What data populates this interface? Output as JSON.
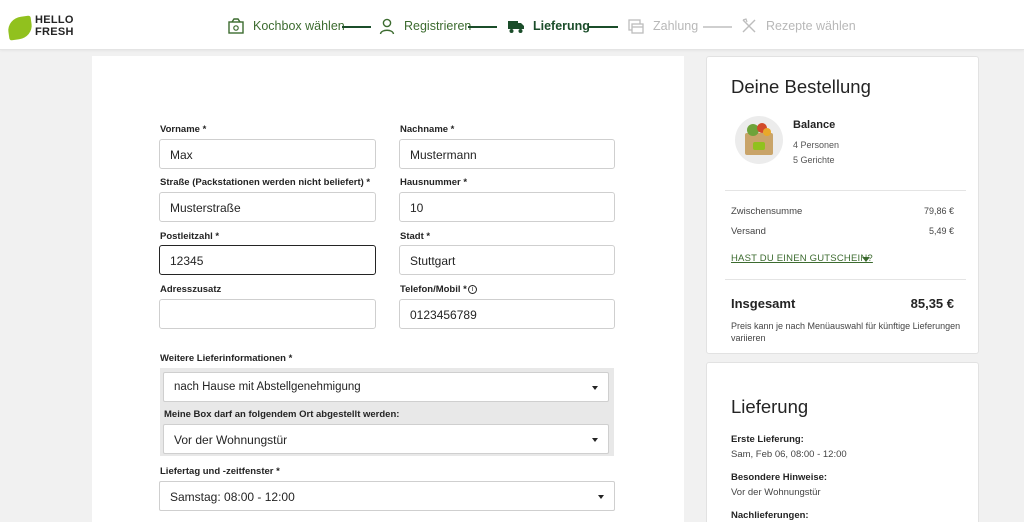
{
  "logo": {
    "line1": "HELLO",
    "line2": "FRESH"
  },
  "steps": [
    {
      "label": "Kochbox wählen",
      "icon": "box-icon",
      "state": "done"
    },
    {
      "label": "Registrieren",
      "icon": "user-icon",
      "state": "done"
    },
    {
      "label": "Lieferung",
      "icon": "truck-icon",
      "state": "current"
    },
    {
      "label": "Zahlung",
      "icon": "payment-icon",
      "state": "todo"
    },
    {
      "label": "Rezepte wählen",
      "icon": "cutlery-icon",
      "state": "todo"
    }
  ],
  "form": {
    "vorname": {
      "label": "Vorname *",
      "value": "Max"
    },
    "nachname": {
      "label": "Nachname *",
      "value": "Mustermann"
    },
    "strasse": {
      "label": "Straße (Packstationen werden nicht beliefert) *",
      "value": "Musterstraße"
    },
    "hausnummer": {
      "label": "Hausnummer *",
      "value": "10"
    },
    "plz": {
      "label": "Postleitzahl *",
      "value": "12345"
    },
    "stadt": {
      "label": "Stadt *",
      "value": "Stuttgart"
    },
    "adresszusatz": {
      "label": "Adresszusatz",
      "value": ""
    },
    "telefon": {
      "label": "Telefon/Mobil *",
      "value": "0123456789"
    },
    "lieferinfo": {
      "label": "Weitere Lieferinformationen *",
      "selected": "nach Hause mit Abstellgenehmigung",
      "sublabel": "Meine Box darf an folgendem Ort abgestellt werden:",
      "ort": "Vor der Wohnungstür"
    },
    "liefertag": {
      "label": "Liefertag und -zeitfenster *",
      "selected": "Samstag: 08:00 - 12:00"
    }
  },
  "order": {
    "title": "Deine Bestellung",
    "product": "Balance",
    "persons": "4 Personen",
    "meals": "5 Gerichte",
    "subtotal_label": "Zwischensumme",
    "subtotal": "79,86 €",
    "shipping_label": "Versand",
    "shipping": "5,49 €",
    "coupon": "HAST DU EINEN GUTSCHEIN?",
    "total_label": "Insgesamt",
    "total": "85,35 €",
    "note": "Preis kann je nach Menüauswahl für künftige Lieferungen variieren"
  },
  "delivery": {
    "title": "Lieferung",
    "first_label": "Erste Lieferung:",
    "first_value": "Sam, Feb 06, 08:00 - 12:00",
    "hint_label": "Besondere Hinweise:",
    "hint_value": "Vor der Wohnungstür",
    "next_label": "Nachlieferungen:"
  },
  "colors": {
    "brand_green": "#91c11e",
    "dark_green": "#1b4d2a",
    "link_green": "#3c6b2f"
  }
}
